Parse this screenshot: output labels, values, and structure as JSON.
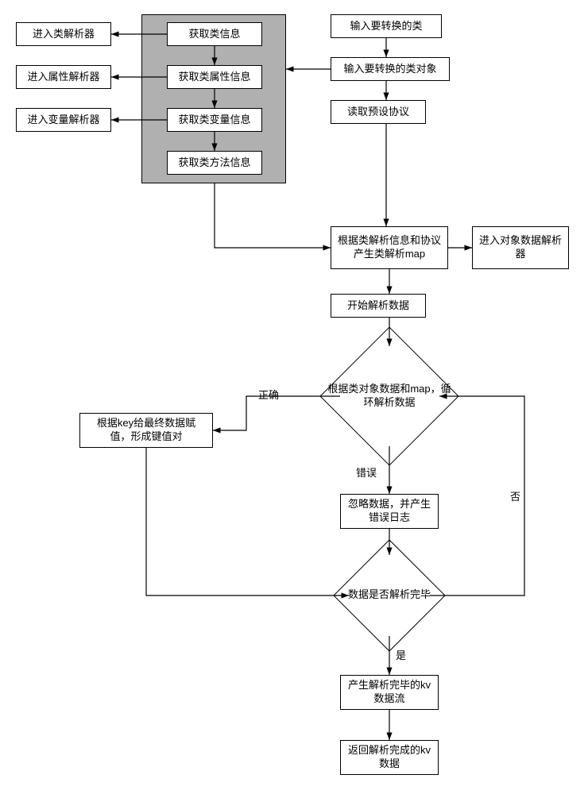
{
  "boxes": {
    "input_class": "输入要转换的类",
    "input_obj": "输入要转换的类对象",
    "read_proto": "读取预设协议",
    "get_class_info": "获取类信息",
    "get_attr_info": "获取类属性信息",
    "get_var_info": "获取类变量信息",
    "get_method_info": "获取类方法信息",
    "enter_class_parser": "进入类解析器",
    "enter_attr_parser": "进入属性解析器",
    "enter_var_parser": "进入变量解析器",
    "gen_map": "根据类解析信息和协议产生类解析map",
    "enter_obj_parser": "进入对象数据解析器",
    "start_parse": "开始解析数据",
    "loop_parse": "根据类对象数据和map，循环解析数据",
    "assign_kv": "根据key给最终数据赋值，形成键值对",
    "ignore_err": "忽略数据，并产生错误日志",
    "done_check": "数据是否解析完毕",
    "gen_kv": "产生解析完毕的kv数据流",
    "return_kv": "返回解析完成的kv数据"
  },
  "labels": {
    "correct": "正确",
    "error": "错误",
    "yes": "是",
    "no": "否"
  }
}
